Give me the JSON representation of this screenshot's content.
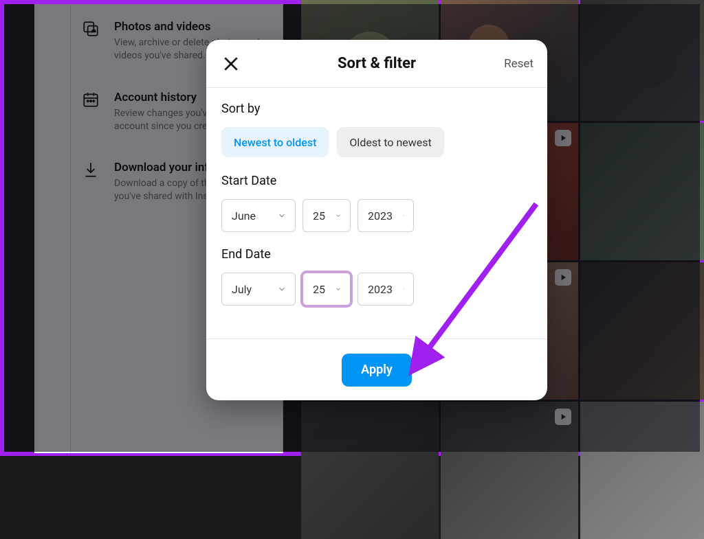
{
  "sidebar": {
    "items": [
      {
        "title": "Photos and videos",
        "desc": "View, archive or delete photos and videos you've shared."
      },
      {
        "title": "Account history",
        "desc": "Review changes you've made to your account since you created it."
      },
      {
        "title": "Download your information",
        "desc": "Download a copy of the information you've shared with Instagram."
      }
    ]
  },
  "dialog": {
    "title": "Sort & filter",
    "reset_label": "Reset",
    "sort_by_label": "Sort by",
    "chips": {
      "newest": "Newest to oldest",
      "oldest": "Oldest to newest"
    },
    "start_date_label": "Start Date",
    "end_date_label": "End Date",
    "start": {
      "month": "June",
      "day": "25",
      "year": "2023"
    },
    "end": {
      "month": "July",
      "day": "25",
      "year": "2023"
    },
    "apply_label": "Apply"
  }
}
